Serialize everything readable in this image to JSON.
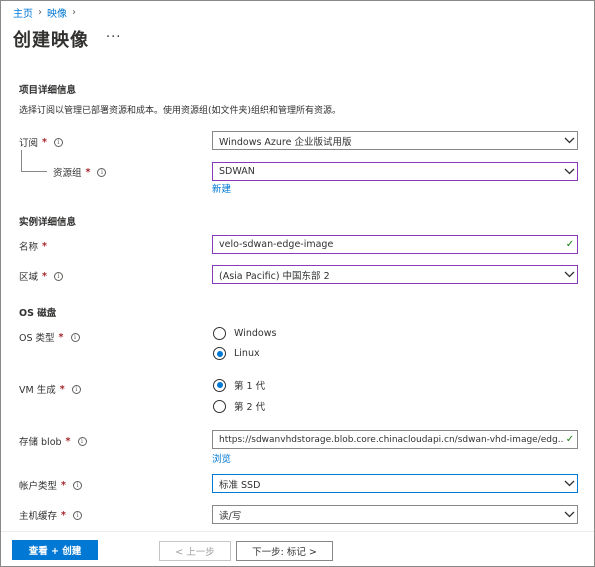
{
  "breadcrumb": [
    {
      "label": "主页"
    },
    {
      "label": "映像"
    }
  ],
  "breadcrumb_sep": "›",
  "page": {
    "title": "创建映像",
    "more": "···"
  },
  "project": {
    "title": "项目详细信息",
    "description": "选择订阅以管理已部署资源和成本。使用资源组(如文件夹)组织和管理所有资源。",
    "subscription": {
      "label": "订阅",
      "value": "Windows Azure 企业版试用版"
    },
    "resource_group": {
      "label": "资源组",
      "value": "SDWAN",
      "new_link": "新建"
    }
  },
  "instance": {
    "title": "实例详细信息",
    "name": {
      "label": "名称",
      "value": "velo-sdwan-edge-image"
    },
    "region": {
      "label": "区域",
      "value": "(Asia Pacific) 中国东部 2"
    }
  },
  "os_disk": {
    "title": "OS 磁盘",
    "os_type": {
      "label": "OS 类型",
      "options": [
        "Windows",
        "Linux"
      ],
      "selected": "Linux"
    },
    "vm_gen": {
      "label": "VM 生成",
      "options": [
        "第 1 代",
        "第 2 代"
      ],
      "selected": "第 1 代"
    },
    "storage_blob": {
      "label": "存储 blob",
      "value": "https://sdwanvhdstorage.blob.core.chinacloudapi.cn/sdwan-vhd-image/edg...",
      "browse_link": "浏览"
    },
    "account_type": {
      "label": "帐户类型",
      "value": "标准 SSD"
    },
    "host_cache": {
      "label": "主机缓存",
      "value": "读/写"
    }
  },
  "required_mark": "*",
  "info_glyph": "i",
  "footer": {
    "review_create": "查看 + 创建",
    "previous": "< 上一步",
    "next": "下一步: 标记 >"
  },
  "colors": {
    "accent": "#0078d4",
    "required": "#a4262c",
    "valid": "#107c10",
    "focus_border": "#8a3ab9"
  },
  "icons": {
    "info": "info-icon",
    "dropdown": "chevron-down-icon",
    "valid": "checkmark-icon"
  }
}
